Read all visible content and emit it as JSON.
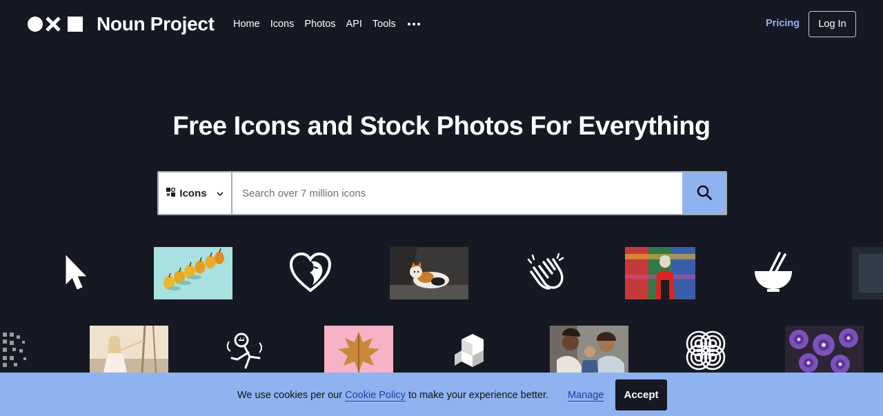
{
  "header": {
    "logo_text": "Noun Project",
    "nav": [
      {
        "label": "Home"
      },
      {
        "label": "Icons"
      },
      {
        "label": "Photos"
      },
      {
        "label": "API"
      },
      {
        "label": "Tools"
      }
    ],
    "more_icon": "ellipsis-icon",
    "pricing_label": "Pricing",
    "login_label": "Log In"
  },
  "hero": {
    "title": "Free Icons and Stock Photos For Everything"
  },
  "search": {
    "type_label": "Icons",
    "placeholder": "Search over 7 million icons",
    "value": "",
    "button_icon": "search-icon"
  },
  "gallery": {
    "row1": [
      "cursor-icon",
      "pears-photo",
      "heart-face-icon",
      "calico-cat-photo",
      "clapping-hands-icon",
      "woman-graffiti-photo",
      "bowl-chopsticks-icon",
      "partial-photo"
    ],
    "row2": [
      "pixel-fade-icon",
      "woman-sailing-photo",
      "person-dancing-icon",
      "golden-leaf-photo",
      "stacked-cubes-icon",
      "family-baby-photo",
      "knot-pattern-icon",
      "purple-flowers-photo"
    ]
  },
  "cookie": {
    "text_before": "We use cookies per our ",
    "link_label": "Cookie Policy",
    "text_after": " to make your experience better.",
    "manage_label": "Manage",
    "accept_label": "Accept"
  },
  "colors": {
    "background": "#161823",
    "accent": "#8fb3f0",
    "link": "#1a3fa8"
  }
}
